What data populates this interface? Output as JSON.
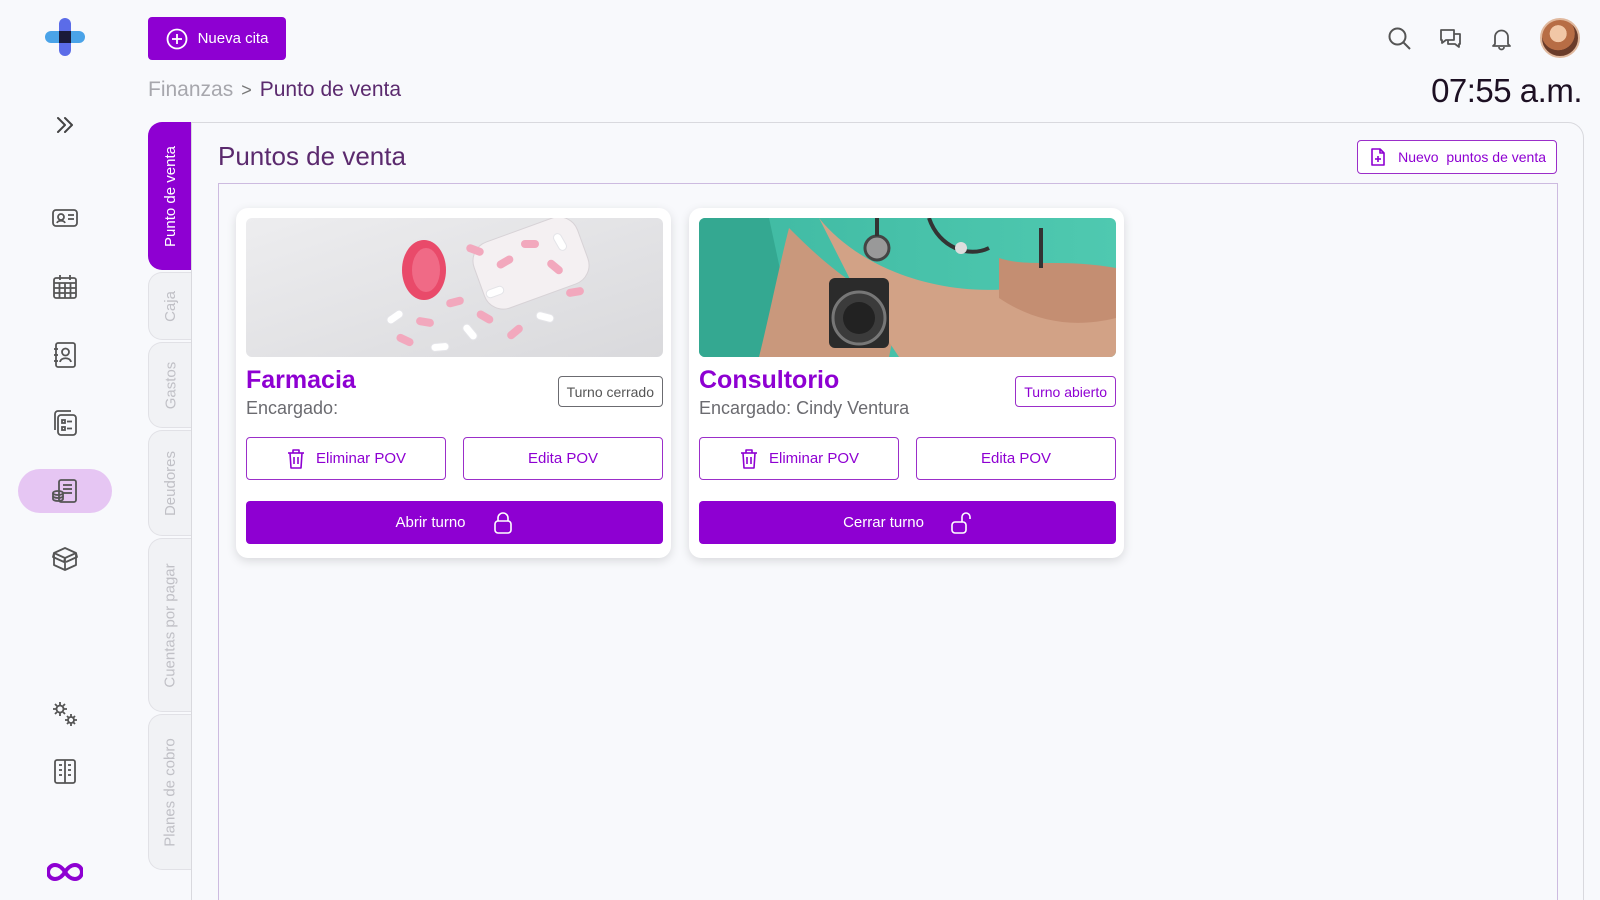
{
  "topbar": {
    "new_appointment_label": "Nueva cita",
    "clock": "07:55 a.m."
  },
  "breadcrumb": {
    "section": "Finanzas",
    "separator": ">",
    "current": "Punto de venta"
  },
  "side_tabs": [
    {
      "label": "Punto de venta",
      "active": true
    },
    {
      "label": "Caja",
      "active": false
    },
    {
      "label": "Gastos",
      "active": false
    },
    {
      "label": "Deudores",
      "active": false
    },
    {
      "label": "Cuentas por pagar",
      "active": false
    },
    {
      "label": "Planes de cobro",
      "active": false
    }
  ],
  "panel": {
    "title": "Puntos de venta",
    "new_pov_label": "Nuevo  puntos de venta"
  },
  "cards": [
    {
      "name": "Farmacia",
      "manager": "Encargado:",
      "status": "Turno cerrado",
      "delete_label": "Eliminar POV",
      "edit_label": "Edita POV",
      "action_label": "Abrir turno"
    },
    {
      "name": "Consultorio",
      "manager": "Encargado: Cindy Ventura",
      "status": "Turno abierto",
      "delete_label": "Eliminar POV",
      "edit_label": "Edita POV",
      "action_label": "Cerrar turno"
    }
  ],
  "colors": {
    "accent": "#8e00d2",
    "accent_light": "#e6c6f3",
    "title": "#5b2a6e"
  },
  "icons": {
    "rail": [
      "logo-cross-icon",
      "expand-icon",
      "id-card-icon",
      "calendar-icon",
      "contacts-icon",
      "records-icon",
      "finance-icon",
      "inventory-box-icon",
      "settings-gears-icon",
      "building-icon",
      "brand-infinity-icon"
    ],
    "top": [
      "search-icon",
      "chat-icon",
      "bell-icon",
      "avatar"
    ]
  }
}
